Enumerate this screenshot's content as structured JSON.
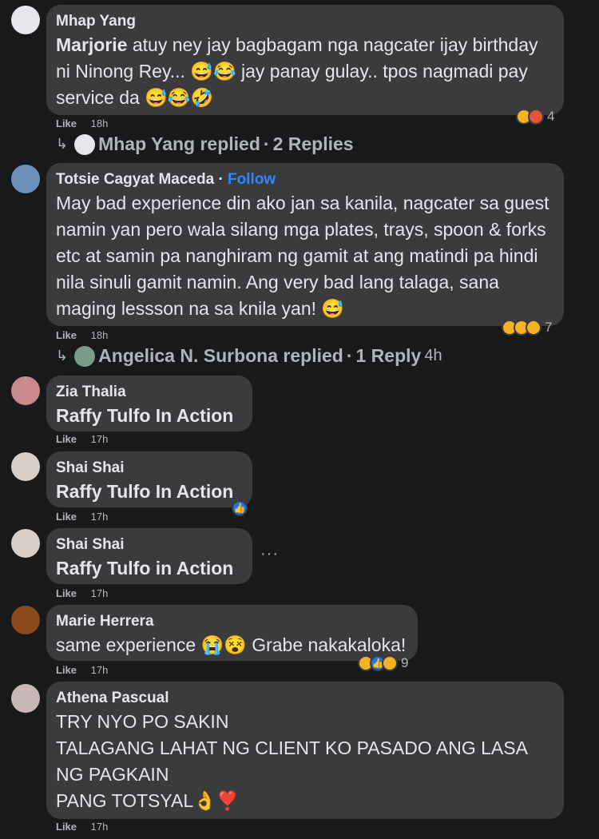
{
  "comments": [
    {
      "name": "Mhap Yang",
      "mention": "Marjorie",
      "text": "atuy ney jay bagbagam nga nagcater ijay birthday ni Ninong Rey... 😅😂 jay panay gulay.. tpos nagmadi pay service da 😅😂🤣",
      "like": "Like",
      "time": "18h",
      "react_count": "4",
      "replies": {
        "by": "Mhap Yang replied",
        "sep": "·",
        "count": "2 Replies"
      }
    },
    {
      "name": "Totsie Cagyat Maceda",
      "follow": "Follow",
      "text": "May bad experience din ako jan sa kanila, nagcater sa guest namin yan pero wala silang mga plates, trays, spoon & forks etc at samin pa nanghiram ng gamit at ang matindi pa hindi nila sinuli gamit namin. Ang very bad lang talaga, sana maging lessson na sa knila yan! 😅",
      "like": "Like",
      "time": "18h",
      "react_count": "7",
      "replies": {
        "by": "Angelica N. Surbona replied",
        "sep": "·",
        "count": "1 Reply",
        "age": "4h"
      }
    },
    {
      "name": "Zia Thalia",
      "text": "Raffy Tulfo In Action",
      "like": "Like",
      "time": "17h"
    },
    {
      "name": "Shai Shai",
      "text": "Raffy Tulfo In Action",
      "like": "Like",
      "time": "17h"
    },
    {
      "name": "Shai Shai",
      "text": "Raffy Tulfo in Action",
      "like": "Like",
      "time": "17h",
      "more": "···"
    },
    {
      "name": "Marie Herrera",
      "text": "same experience 😭😵 Grabe nakakaloka!",
      "like": "Like",
      "time": "17h",
      "react_count": "9"
    },
    {
      "name": "Athena Pascual",
      "lines": [
        "TRY NYO PO SAKIN",
        "TALAGANG LAHAT NG CLIENT KO PASADO ANG LASA",
        "NG PAGKAIN",
        "PANG TOTSYAL👌❣️"
      ],
      "like": "Like",
      "time": "17h"
    }
  ],
  "colors": {
    "background": "#18191a",
    "bubble": "#3a3b3c",
    "follow": "#2d88ff"
  }
}
